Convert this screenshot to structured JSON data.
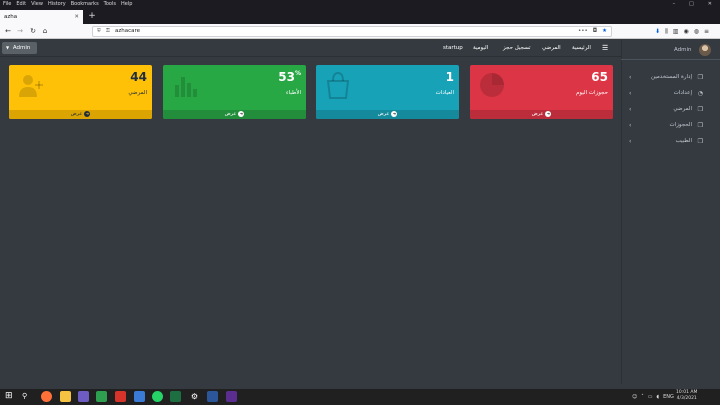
{
  "browser": {
    "menu": [
      "File",
      "Edit",
      "View",
      "History",
      "Bookmarks",
      "Tools",
      "Help"
    ],
    "window_controls": [
      "–",
      "□",
      "✕"
    ],
    "tab_title": "azha",
    "url": "azhacare"
  },
  "app": {
    "admin_dropdown": "Admin",
    "nav_links": [
      "الرئيسية",
      "المرضي",
      "تسجيل حجز",
      "اليومية",
      "startup"
    ],
    "sidebar": {
      "user": "Admin",
      "items": [
        {
          "label": "إدارة المستخدمين",
          "icon": "copy-icon"
        },
        {
          "label": "إعدادات",
          "icon": "dashboard-icon"
        },
        {
          "label": "المرضي",
          "icon": "copy-icon"
        },
        {
          "label": "الحجوزات",
          "icon": "copy-icon"
        },
        {
          "label": "الطبيب",
          "icon": "copy-icon"
        }
      ]
    },
    "cards": [
      {
        "value": "44",
        "suffix": "",
        "label": "المرضي",
        "footer": "عرض",
        "icon": "user-plus-icon",
        "color": "#ffc107"
      },
      {
        "value": "53",
        "suffix": "%",
        "label": "الأطباء",
        "footer": "عرض",
        "icon": "bar-chart-icon",
        "color": "#28a745"
      },
      {
        "value": "1",
        "suffix": "",
        "label": "العيادات",
        "footer": "عرض",
        "icon": "shopping-bag-icon",
        "color": "#17a2b8"
      },
      {
        "value": "65",
        "suffix": "",
        "label": "حجوزات اليوم",
        "footer": "عرض",
        "icon": "pie-chart-icon",
        "color": "#dc3545"
      }
    ]
  },
  "taskbar": {
    "language": "ENG",
    "time": "10:01 AM",
    "date": "4/3/2021"
  }
}
